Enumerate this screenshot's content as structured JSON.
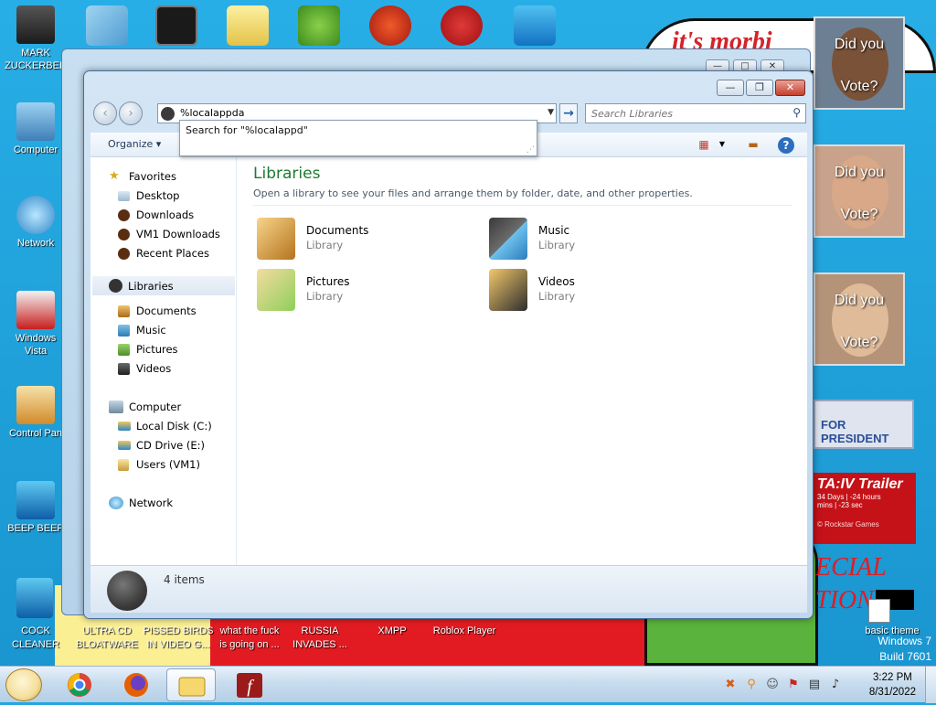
{
  "desktop": {
    "left_icons": [
      {
        "label": "MARK\nZUCKERBER"
      },
      {
        "label": "Computer"
      },
      {
        "label": "Network"
      },
      {
        "label": "Windows\nVista"
      },
      {
        "label": "Control Pan"
      },
      {
        "label": "BEEP BEEP"
      }
    ],
    "bottom_labels": [
      "COCK\nCLEANER",
      "ULTRA CD\nBLOATWARE",
      "PISSED BIRDS\nIN VIDEO G...",
      "what the fuck\nis going on ...",
      "RUSSIA\nINVADES ...",
      "XMPP",
      "Roblox Player",
      "basic theme"
    ],
    "wallpaper": {
      "banner_text": "it's morbi",
      "posters": [
        {
          "line1": "Did you",
          "line2": "Vote?"
        },
        {
          "line1": "Did you",
          "line2": "Vote?"
        },
        {
          "line1": "Did you",
          "line2": "Vote?"
        }
      ],
      "president_text": "FOR PRESIDENT",
      "gta_title": "TA:IV Trailer",
      "gta_line1": "34 Days | -24 hours",
      "gta_line2": "mins | -23 sec",
      "gta_line3": "© Rockstar Games",
      "special_line1": "ECIAL",
      "special_line2": "TION",
      "watermark_line1": "Windows 7",
      "watermark_line2": "Build 7601"
    }
  },
  "explorer": {
    "address_value": "%localappda",
    "search_placeholder": "Search Libraries",
    "suggestion": "Search for \"%localappd\"",
    "toolbar": {
      "organize": "Organize ▾"
    },
    "nav": {
      "favorites": "Favorites",
      "desktop": "Desktop",
      "downloads": "Downloads",
      "vm1_downloads": "VM1 Downloads",
      "recent_places": "Recent Places",
      "libraries": "Libraries",
      "documents": "Documents",
      "music": "Music",
      "pictures": "Pictures",
      "videos": "Videos",
      "computer": "Computer",
      "local_disk": "Local Disk (C:)",
      "cd_drive": "CD Drive (E:)",
      "users": "Users (VM1)",
      "network": "Network"
    },
    "main": {
      "title": "Libraries",
      "subtitle": "Open a library to see your files and arrange them by folder, date, and other properties.",
      "items": [
        {
          "name": "Documents",
          "type": "Library"
        },
        {
          "name": "Music",
          "type": "Library"
        },
        {
          "name": "Pictures",
          "type": "Library"
        },
        {
          "name": "Videos",
          "type": "Library"
        }
      ]
    },
    "details": {
      "count": "4 items"
    }
  },
  "taskbar": {
    "time": "3:22 PM",
    "date": "8/31/2022"
  },
  "colors": {
    "library_title": "#1e7a31",
    "desktop_bg": "#23a6df"
  }
}
